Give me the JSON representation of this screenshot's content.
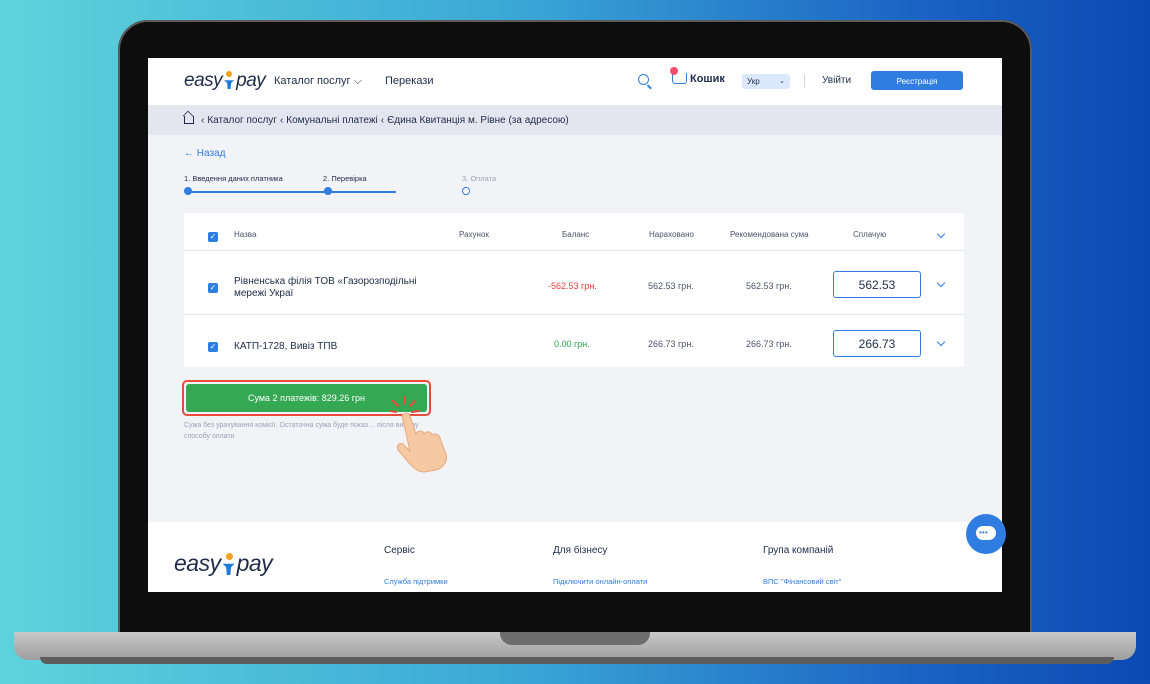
{
  "header": {
    "logo": "easypay",
    "nav": [
      "Каталог послуг",
      "Перекази"
    ],
    "cart_label": "Кошик",
    "language": "Укр",
    "login_label": "Увійти",
    "register_label": "Реєстрація"
  },
  "breadcrumb": {
    "items": [
      "Каталог послуг",
      "Комунальні платежі",
      "Єдина Квитанція м. Рівне (за адресою)"
    ]
  },
  "back_label": "← Назад",
  "steps": [
    "1. Введення даних платника",
    "2. Перевірка",
    "3. Оплата"
  ],
  "table": {
    "headers": [
      "Назва",
      "Рахунок",
      "Баланс",
      "Нараховано",
      "Рекомендована сума",
      "Сплачую"
    ],
    "rows": [
      {
        "name": "Рівненська філія ТОВ «Газорозподільні мережі Украї",
        "balance": "-562.53 грн.",
        "balance_color": "#ee3b3b",
        "accrued": "562.53 грн.",
        "recommended": "562.53 грн.",
        "pay": "562.53"
      },
      {
        "name": "КАТП-1728, Вивіз ТПВ",
        "balance": "0.00 грн.",
        "balance_color": "#26a64a",
        "accrued": "266.73 грн.",
        "recommended": "266.73 грн.",
        "pay": "266.73"
      }
    ]
  },
  "pay_button_label": "Сума 2 платежів: 829.26 грн",
  "note": "Сума без урахування комісії. Остаточна сума буде показ… після вибору способу оплати",
  "footer": {
    "logo": "easypay",
    "columns": [
      {
        "title": "Сервіс",
        "link": "Служба підтримки"
      },
      {
        "title": "Для бізнесу",
        "link": "Підключити онлайн-оплати"
      },
      {
        "title": "Група компаній",
        "link": "ВПС \"Фінансовий світ\""
      }
    ]
  },
  "colors": {
    "accent": "#2f7de1",
    "pay_button": "#34a853",
    "highlight_ring": "#e94b3b"
  }
}
